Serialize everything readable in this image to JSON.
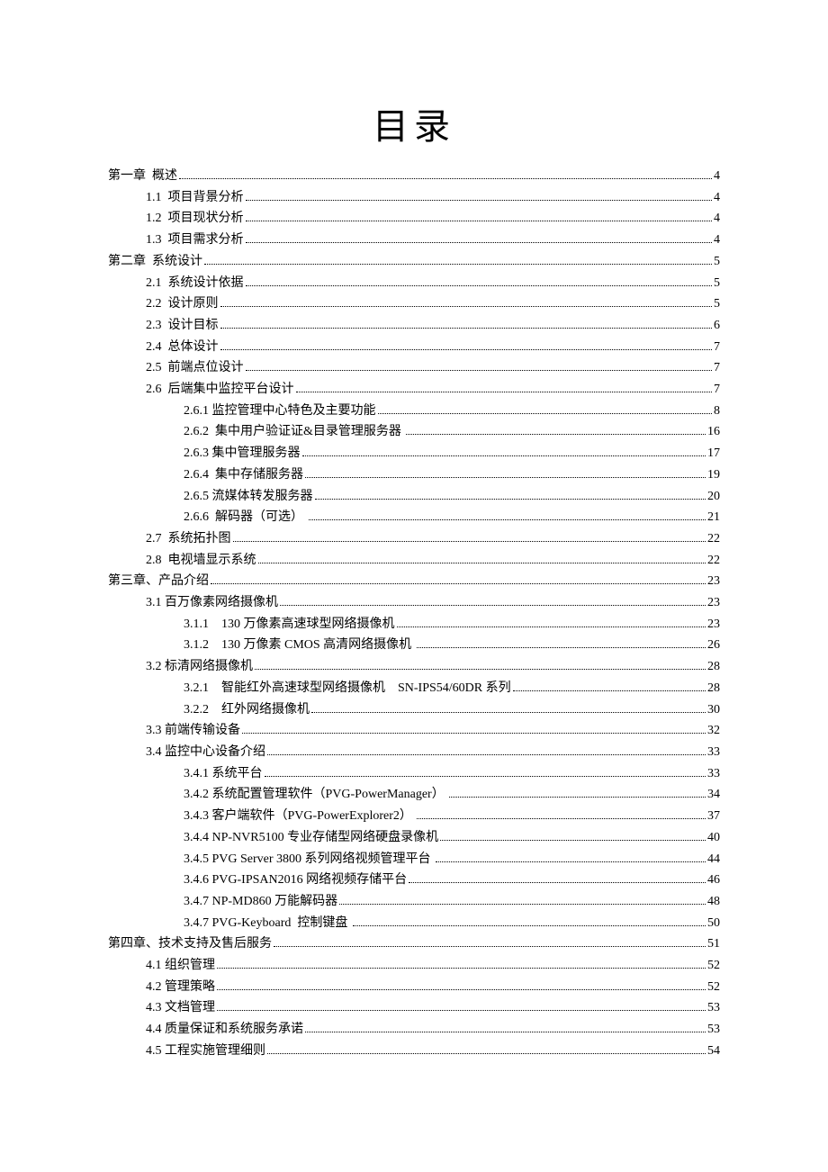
{
  "title": "目录",
  "toc": [
    {
      "level": 0,
      "label": "第一章  概述",
      "page": "4"
    },
    {
      "level": 1,
      "label": "1.1  项目背景分析",
      "page": "4"
    },
    {
      "level": 1,
      "label": "1.2  项目现状分析",
      "page": "4"
    },
    {
      "level": 1,
      "label": "1.3  项目需求分析",
      "page": "4"
    },
    {
      "level": 0,
      "label": "第二章  系统设计",
      "page": "5"
    },
    {
      "level": 1,
      "label": "2.1  系统设计依据",
      "page": "5"
    },
    {
      "level": 1,
      "label": "2.2  设计原则",
      "page": "5"
    },
    {
      "level": 1,
      "label": "2.3  设计目标",
      "page": "6"
    },
    {
      "level": 1,
      "label": "2.4  总体设计",
      "page": "7"
    },
    {
      "level": 1,
      "label": "2.5  前端点位设计",
      "page": "7"
    },
    {
      "level": 1,
      "label": "2.6  后端集中监控平台设计",
      "page": "7"
    },
    {
      "level": 2,
      "label": "2.6.1 监控管理中心特色及主要功能",
      "page": "8"
    },
    {
      "level": 2,
      "label": "2.6.2  集中用户验证证&目录管理服务器 ",
      "page": "16"
    },
    {
      "level": 2,
      "label": "2.6.3 集中管理服务器",
      "page": "17"
    },
    {
      "level": 2,
      "label": "2.6.4  集中存储服务器",
      "page": "19"
    },
    {
      "level": 2,
      "label": "2.6.5 流媒体转发服务器",
      "page": "20"
    },
    {
      "level": 2,
      "label": "2.6.6  解码器（可选） ",
      "page": "21"
    },
    {
      "level": 1,
      "label": "2.7  系统拓扑图",
      "page": "22"
    },
    {
      "level": 1,
      "label": "2.8  电视墙显示系统",
      "page": "22"
    },
    {
      "level": 0,
      "label": "第三章、产品介绍",
      "page": "23"
    },
    {
      "level": 1,
      "label": "3.1 百万像素网络摄像机",
      "page": "23"
    },
    {
      "level": 2,
      "label": "3.1.1    130 万像素高速球型网络摄像机",
      "page": "23"
    },
    {
      "level": 2,
      "label": "3.1.2    130 万像素 CMOS 高清网络摄像机 ",
      "page": "26"
    },
    {
      "level": 1,
      "label": "3.2 标清网络摄像机",
      "page": "28"
    },
    {
      "level": 2,
      "label": "3.2.1    智能红外高速球型网络摄像机    SN-IPS54/60DR 系列",
      "page": "28"
    },
    {
      "level": 2,
      "label": "3.2.2    红外网络摄像机",
      "page": "30"
    },
    {
      "level": 1,
      "label": "3.3 前端传输设备",
      "page": "32"
    },
    {
      "level": 1,
      "label": "3.4 监控中心设备介绍",
      "page": "33"
    },
    {
      "level": 2,
      "label": "3.4.1 系统平台",
      "page": "33"
    },
    {
      "level": 2,
      "label": "3.4.2 系统配置管理软件（PVG-PowerManager） ",
      "page": "34"
    },
    {
      "level": 2,
      "label": "3.4.3 客户端软件（PVG-PowerExplorer2） ",
      "page": "37"
    },
    {
      "level": 2,
      "label": "3.4.4 NP-NVR5100 专业存储型网络硬盘录像机",
      "page": "40"
    },
    {
      "level": 2,
      "label": "3.4.5 PVG Server 3800 系列网络视频管理平台 ",
      "page": "44"
    },
    {
      "level": 2,
      "label": "3.4.6 PVG-IPSAN2016 网络视频存储平台",
      "page": "46"
    },
    {
      "level": 2,
      "label": "3.4.7 NP-MD860 万能解码器",
      "page": "48"
    },
    {
      "level": 2,
      "label": "3.4.7 PVG-Keyboard  控制键盘 ",
      "page": "50"
    },
    {
      "level": 0,
      "label": "第四章、技术支持及售后服务",
      "page": "51"
    },
    {
      "level": 1,
      "label": "4.1 组织管理",
      "page": "52"
    },
    {
      "level": 1,
      "label": "4.2 管理策略",
      "page": "52"
    },
    {
      "level": 1,
      "label": "4.3 文档管理",
      "page": "53"
    },
    {
      "level": 1,
      "label": "4.4 质量保证和系统服务承诺",
      "page": "53"
    },
    {
      "level": 1,
      "label": "4.5 工程实施管理细则",
      "page": "54"
    }
  ]
}
